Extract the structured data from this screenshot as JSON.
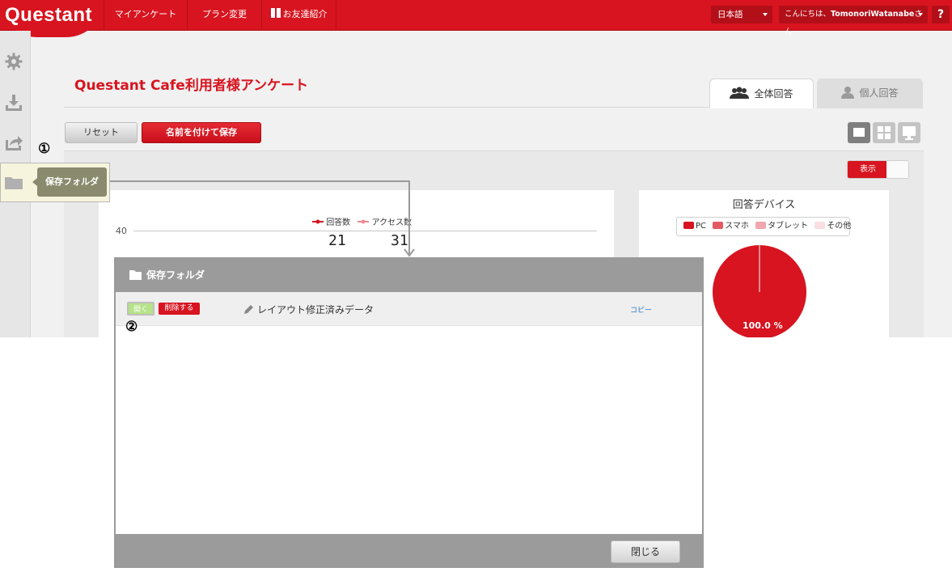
{
  "topbar": {
    "logo": "Questant",
    "nav": [
      "マイアンケート",
      "プラン変更",
      "お友達紹介"
    ],
    "language": "日本語",
    "greeting_prefix": "こんにちは、",
    "greeting_name": "TomonoriWatanabe",
    "greeting_suffix": "さん",
    "help": "?"
  },
  "page": {
    "title": "Questant Cafe利用者様アンケート",
    "tabs": [
      "全体回答",
      "個人回答"
    ],
    "reset_label": "リセット",
    "save_label": "名前を付けて保存",
    "toggle_label": "表示"
  },
  "chart_left": {
    "legend": [
      "回答数",
      "アクセス数"
    ],
    "axis_tick": "40",
    "responses": "21",
    "access": "31"
  },
  "chart_data": {
    "type": "pie",
    "title": "回答デバイス",
    "categories": [
      "PC",
      "スマホ",
      "タブレット",
      "その他"
    ],
    "values": [
      100.0,
      0,
      0,
      0
    ],
    "slice_label": "100.0 %",
    "colors": [
      "#d7141f",
      "#e45a62",
      "#f0a7ad",
      "#f9dfe1"
    ]
  },
  "callout": {
    "marker1": "①",
    "marker2": "②",
    "label": "保存フォルダ"
  },
  "modal": {
    "title": "保存フォルダ",
    "rows": [
      {
        "open": "開く",
        "delete": "削除する",
        "name": "レイアウト修正済みデータ",
        "copy": "コピー"
      }
    ],
    "close_label": "閉じる"
  },
  "colors": {
    "brand": "#d7141f",
    "open_button": "#b6e289",
    "modal_frame": "#9b9b9b"
  }
}
